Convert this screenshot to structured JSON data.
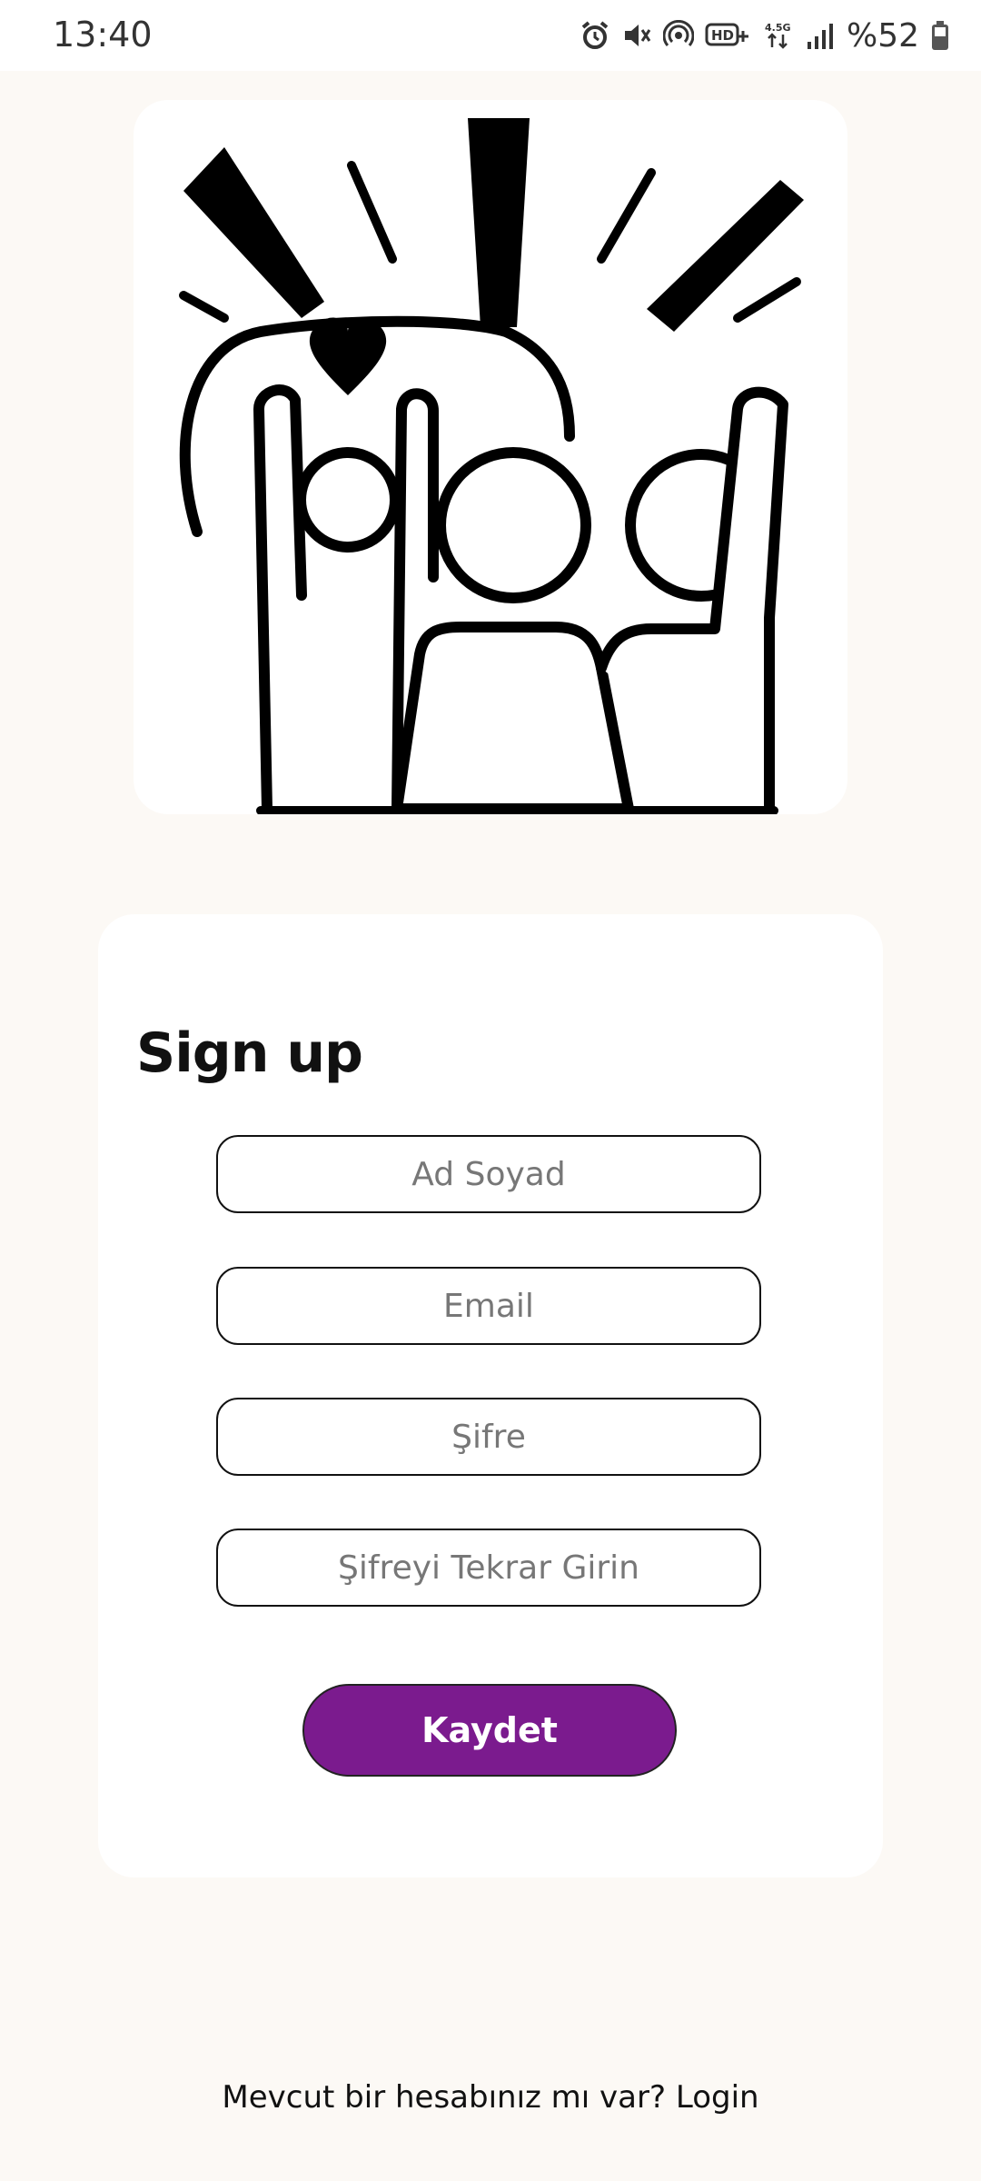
{
  "status_bar": {
    "time": "13:40",
    "icons": [
      "alarm-icon",
      "mute-icon",
      "hotspot-icon",
      "hd-voice-icon",
      "network-4.5g-icon",
      "signal-icon",
      "battery-icon"
    ],
    "battery": "%52"
  },
  "illustration": {
    "icon": "celebrating-friends-illustration"
  },
  "form": {
    "title": "Sign up",
    "fields": [
      {
        "placeholder": "Ad Soyad",
        "value": ""
      },
      {
        "placeholder": "Email",
        "value": ""
      },
      {
        "placeholder": "Şifre",
        "value": ""
      },
      {
        "placeholder": "Şifreyi Tekrar Girin",
        "value": ""
      }
    ],
    "submit_label": "Kaydet",
    "accent_color": "#7b1b8e"
  },
  "footer": {
    "prompt": "Mevcut bir hesabınız mı var?",
    "login_label": "Login"
  }
}
